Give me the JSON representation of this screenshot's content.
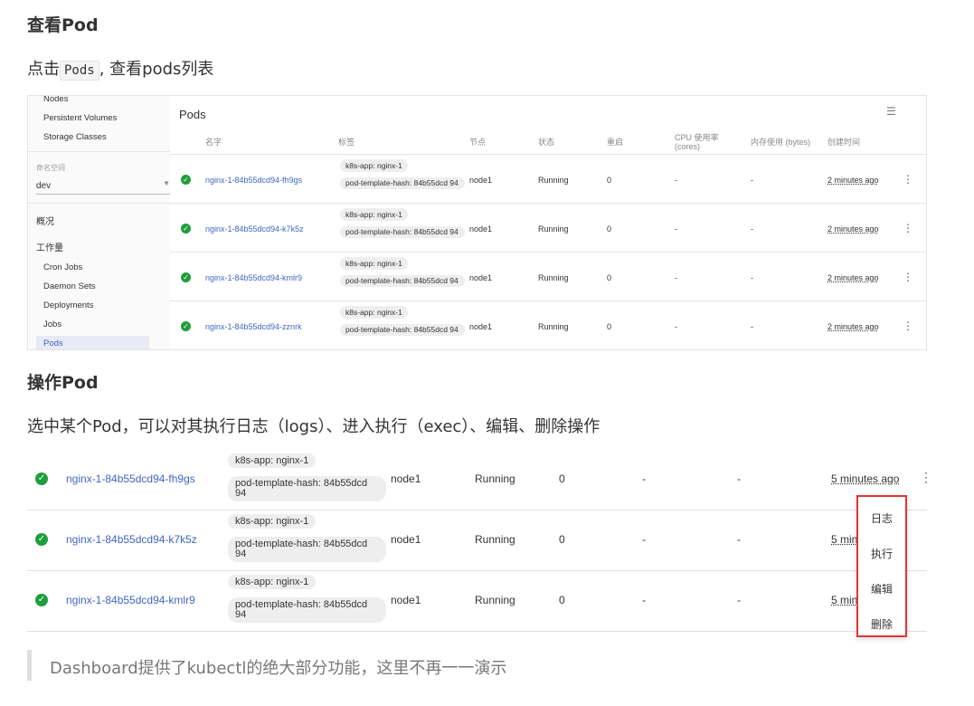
{
  "section1": {
    "heading": "查看Pod",
    "text_before": "点击",
    "code": "Pods",
    "text_after": ", 查看pods列表"
  },
  "screenshot1": {
    "sidebar": {
      "items_top": [
        "Nodes",
        "Persistent Volumes",
        "Storage Classes"
      ],
      "namespace_caption": "命名空间",
      "namespace_value": "dev",
      "overview": "概况",
      "workloads": "工作量",
      "items_workloads": [
        "Cron Jobs",
        "Daemon Sets",
        "Deployments",
        "Jobs",
        "Pods"
      ]
    },
    "title": "Pods",
    "columns": [
      "名字",
      "标签",
      "节点",
      "状态",
      "重启",
      "CPU 使用率",
      "(cores)",
      "内存使用 (bytes)",
      "创建时间"
    ],
    "rows": [
      {
        "name": "nginx-1-84b55dcd94-fh9gs",
        "label1": "k8s-app: nginx-1",
        "label2": "pod-template-hash: 84b55dcd 94",
        "node": "node1",
        "status": "Running",
        "restarts": "0",
        "cpu": "-",
        "mem": "-",
        "age": "2 minutes ago"
      },
      {
        "name": "nginx-1-84b55dcd94-k7k5z",
        "label1": "k8s-app: nginx-1",
        "label2": "pod-template-hash: 84b55dcd 94",
        "node": "node1",
        "status": "Running",
        "restarts": "0",
        "cpu": "-",
        "mem": "-",
        "age": "2 minutes ago"
      },
      {
        "name": "nginx-1-84b55dcd94-kmlr9",
        "label1": "k8s-app: nginx-1",
        "label2": "pod-template-hash: 84b55dcd 94",
        "node": "node1",
        "status": "Running",
        "restarts": "0",
        "cpu": "-",
        "mem": "-",
        "age": "2 minutes ago"
      },
      {
        "name": "nginx-1-84b55dcd94-zznrk",
        "label1": "k8s-app: nginx-1",
        "label2": "pod-template-hash: 84b55dcd 94",
        "node": "node1",
        "status": "Running",
        "restarts": "0",
        "cpu": "-",
        "mem": "-",
        "age": "2 minutes ago"
      }
    ]
  },
  "section2": {
    "heading": "操作Pod",
    "text": "选中某个Pod，可以对其执行日志（logs）、进入执行（exec）、编辑、删除操作"
  },
  "screenshot2": {
    "rows": [
      {
        "name": "nginx-1-84b55dcd94-fh9gs",
        "label1": "k8s-app: nginx-1",
        "label2": "pod-template-hash: 84b55dcd 94",
        "node": "node1",
        "status": "Running",
        "restarts": "0",
        "cpu": "-",
        "mem": "-",
        "age": "5 minutes ago"
      },
      {
        "name": "nginx-1-84b55dcd94-k7k5z",
        "label1": "k8s-app: nginx-1",
        "label2": "pod-template-hash: 84b55dcd 94",
        "node": "node1",
        "status": "Running",
        "restarts": "0",
        "cpu": "-",
        "mem": "-",
        "age": "5 min"
      },
      {
        "name": "nginx-1-84b55dcd94-kmlr9",
        "label1": "k8s-app: nginx-1",
        "label2": "pod-template-hash: 84b55dcd 94",
        "node": "node1",
        "status": "Running",
        "restarts": "0",
        "cpu": "-",
        "mem": "-",
        "age": "5 min"
      }
    ],
    "menu": [
      "日志",
      "执行",
      "编辑",
      "删除"
    ]
  },
  "quote": "Dashboard提供了kubectl的绝大部分功能，这里不再一一演示",
  "colors": {
    "running": "#1e9e3c",
    "link": "#3f66c4",
    "highlight": "#e03535"
  }
}
